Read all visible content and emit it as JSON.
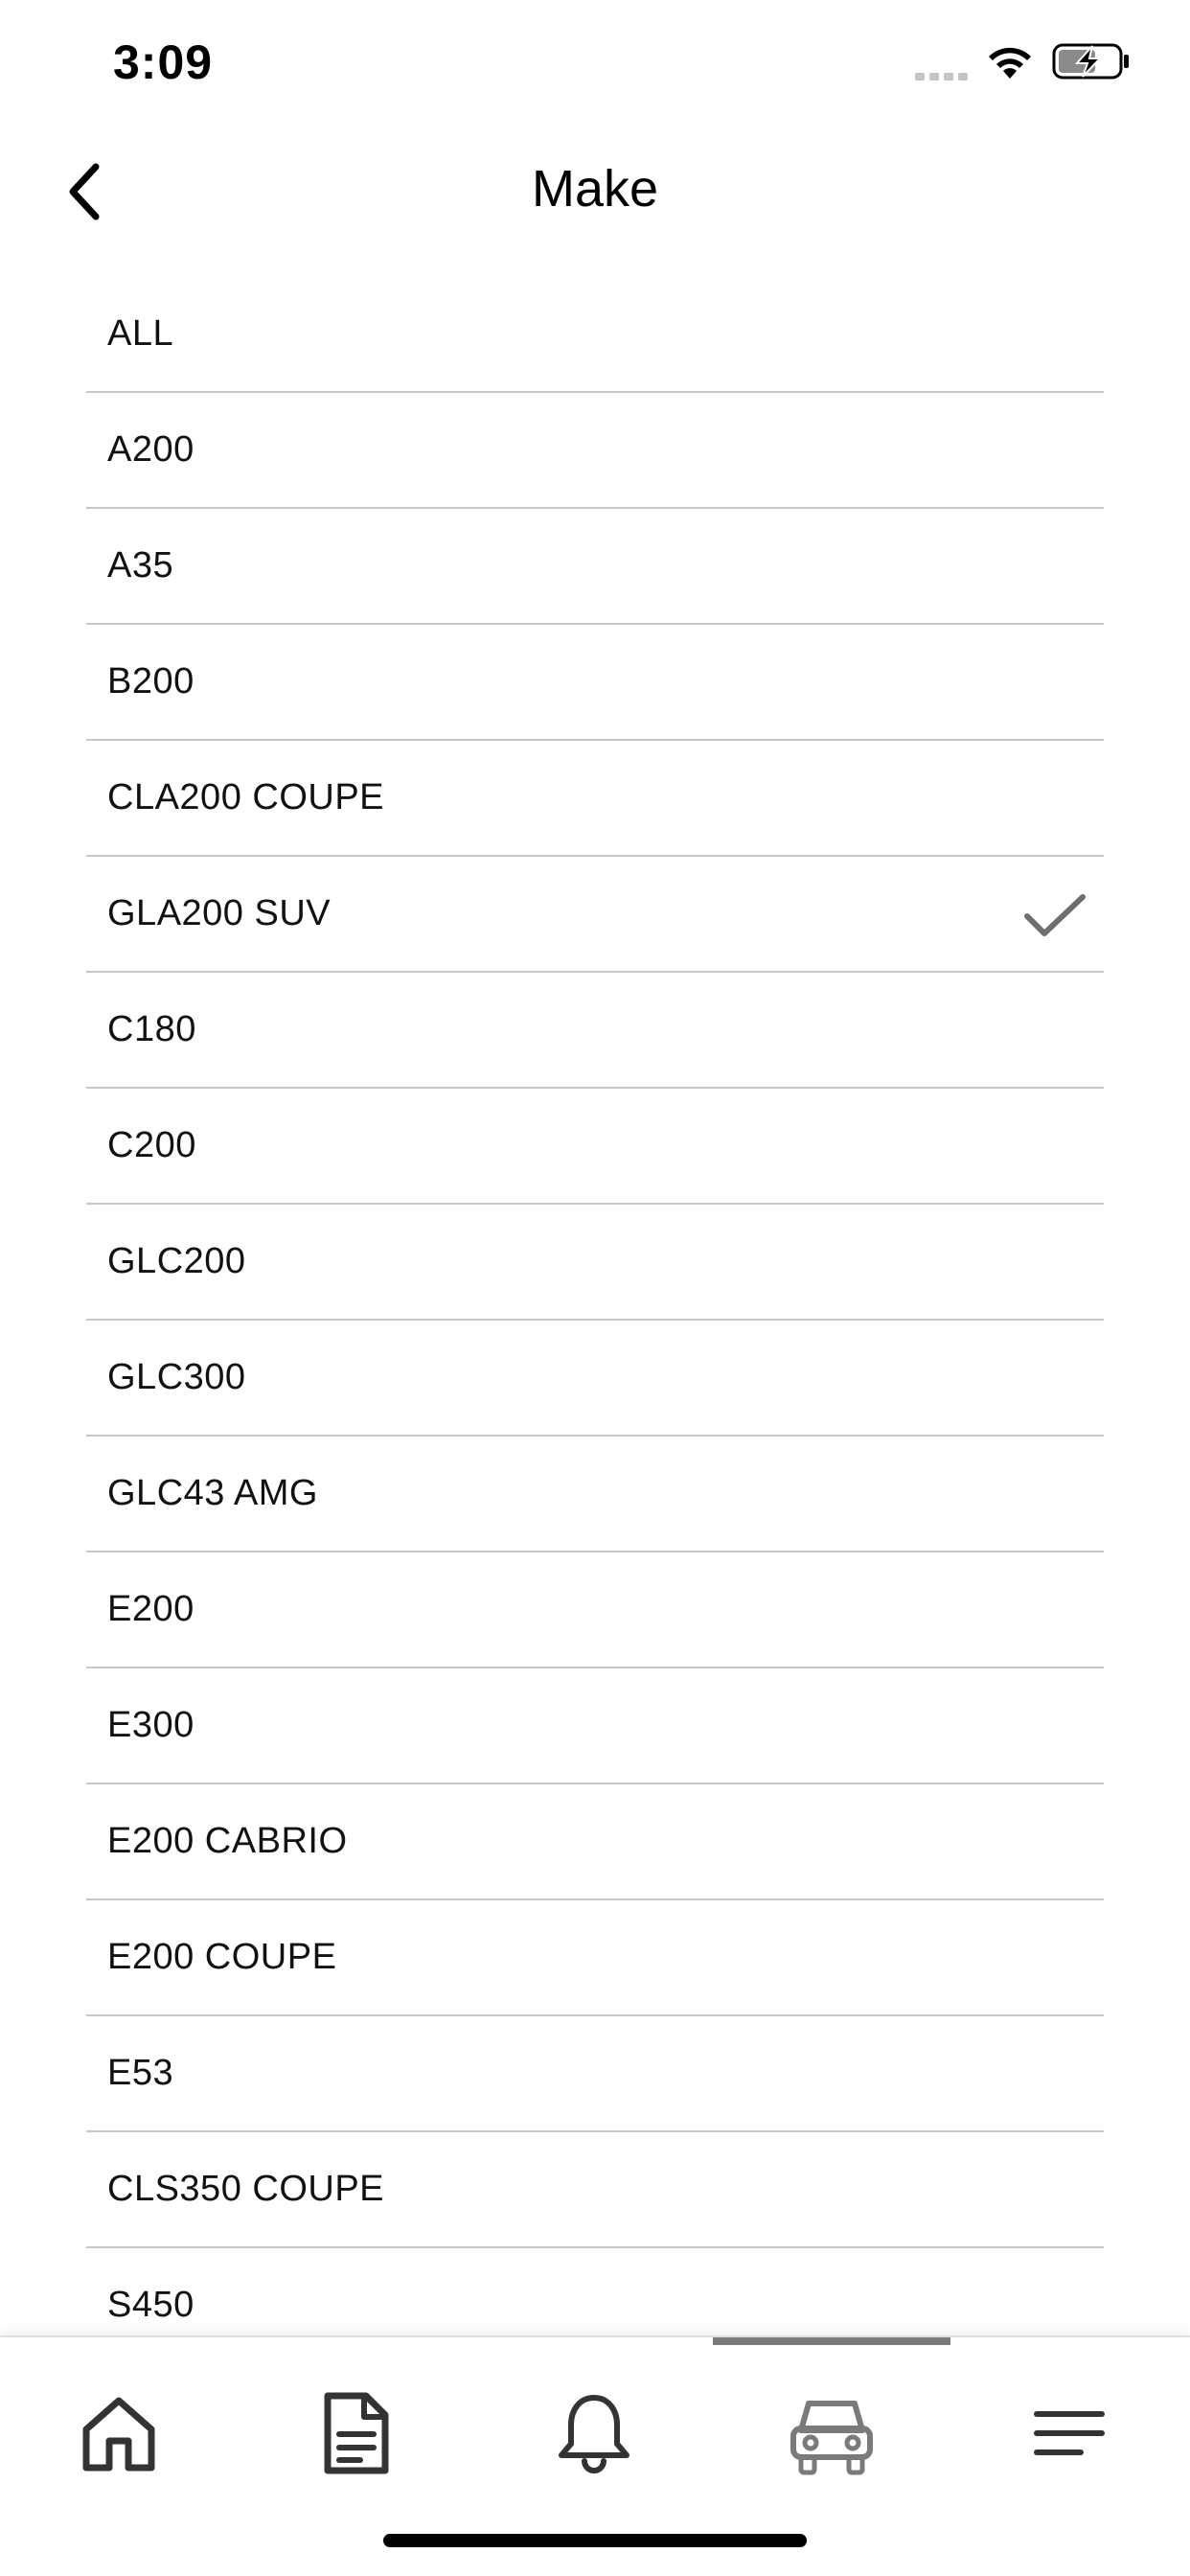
{
  "status_bar": {
    "time": "3:09"
  },
  "nav": {
    "title": "Make",
    "back_icon": "chevron-left-icon"
  },
  "list": {
    "selected": "GLA200 SUV",
    "items": [
      {
        "label": "ALL",
        "selected": false
      },
      {
        "label": "A200",
        "selected": false
      },
      {
        "label": "A35",
        "selected": false
      },
      {
        "label": "B200",
        "selected": false
      },
      {
        "label": "CLA200 COUPE",
        "selected": false
      },
      {
        "label": "GLA200 SUV",
        "selected": true
      },
      {
        "label": "C180",
        "selected": false
      },
      {
        "label": "C200",
        "selected": false
      },
      {
        "label": "GLC200",
        "selected": false
      },
      {
        "label": "GLC300",
        "selected": false
      },
      {
        "label": "GLC43 AMG",
        "selected": false
      },
      {
        "label": "E200",
        "selected": false
      },
      {
        "label": "E300",
        "selected": false
      },
      {
        "label": "E200 CABRIO",
        "selected": false
      },
      {
        "label": "E200 COUPE",
        "selected": false
      },
      {
        "label": "E53",
        "selected": false
      },
      {
        "label": "CLS350 COUPE",
        "selected": false
      },
      {
        "label": "S450",
        "selected": false
      }
    ]
  },
  "tab_bar": {
    "active": "car",
    "tabs": [
      {
        "icon": "home-icon"
      },
      {
        "icon": "document-icon"
      },
      {
        "icon": "bell-icon"
      },
      {
        "icon": "car-icon"
      },
      {
        "icon": "menu-icon"
      }
    ]
  },
  "colors": {
    "divider": "#c8c8c8",
    "icon_active": "#7a7a7a",
    "icon_default": "#333333",
    "checkmark": "#6e6e6e"
  }
}
